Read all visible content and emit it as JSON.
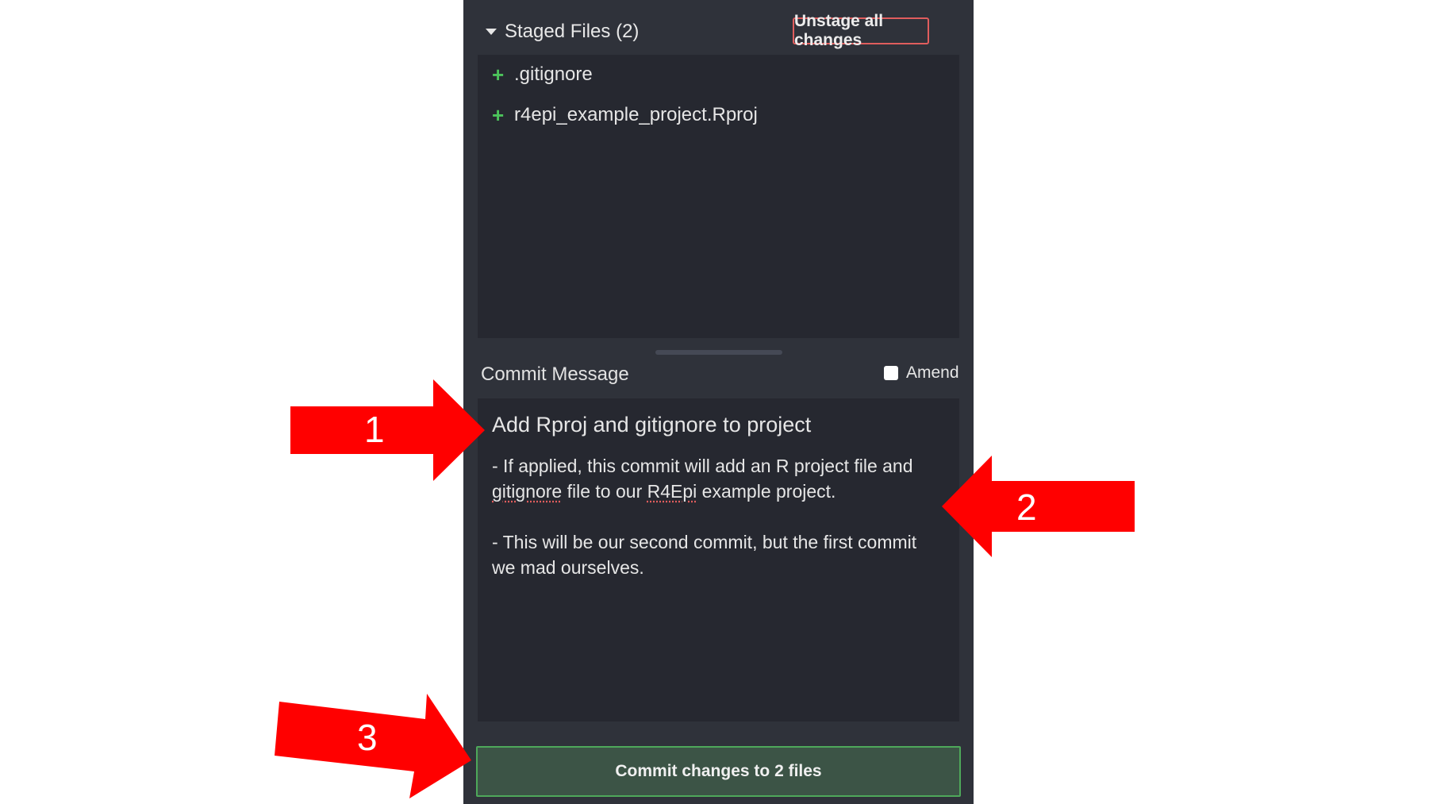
{
  "staged": {
    "title": "Staged Files (2)",
    "unstage_label": "Unstage all changes",
    "files": [
      {
        "status": "+",
        "name": ".gitignore"
      },
      {
        "status": "+",
        "name": "r4epi_example_project.Rproj"
      }
    ]
  },
  "commit": {
    "label": "Commit Message",
    "amend_label": "Amend",
    "subject": "Add Rproj and gitignore to project",
    "body_line1": "- If applied, this commit will add an R project file and",
    "body_line2_word1": "gitignore",
    "body_line2_mid": " file to our ",
    "body_line2_word2": "R4Epi",
    "body_line2_end": " example project.",
    "body_line3": "- This will be our second commit, but the first commit",
    "body_line4": "we mad ourselves.",
    "button_label": "Commit changes to 2 files"
  },
  "annotations": {
    "arrow1": "1",
    "arrow2": "2",
    "arrow3": "3",
    "color": "#ff0000"
  }
}
